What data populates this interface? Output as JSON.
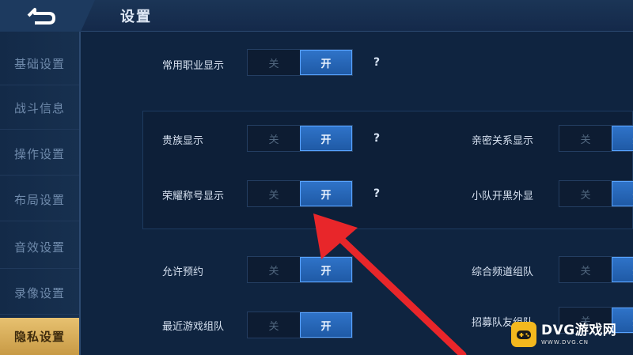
{
  "header": {
    "title": "设置",
    "back_icon": "back-arrow-icon"
  },
  "sidebar": {
    "items": [
      {
        "label": "基础设置",
        "active": false
      },
      {
        "label": "战斗信息",
        "active": false
      },
      {
        "label": "操作设置",
        "active": false
      },
      {
        "label": "布局设置",
        "active": false
      },
      {
        "label": "音效设置",
        "active": false
      },
      {
        "label": "录像设置",
        "active": false
      },
      {
        "label": "隐私设置",
        "active": true
      }
    ]
  },
  "settings": {
    "common_role": {
      "label": "常用职业显示",
      "off": "关",
      "on": "开",
      "value": "on",
      "help": "?"
    },
    "noble": {
      "label": "贵族显示",
      "off": "关",
      "on": "开",
      "value": "on",
      "help": "?"
    },
    "intimate": {
      "label": "亲密关系显示",
      "off": "关",
      "on": "开",
      "value": "on"
    },
    "honor_title": {
      "label": "荣耀称号显示",
      "off": "关",
      "on": "开",
      "value": "on",
      "help": "?"
    },
    "team_appearance": {
      "label": "小队开黑外显",
      "off": "关",
      "on": "开",
      "value": "on"
    },
    "allow_reserve": {
      "label": "允许预约",
      "off": "关",
      "on": "开",
      "value": "on"
    },
    "general_channel": {
      "label": "综合频道组队",
      "off": "关",
      "on": "开",
      "value": "on"
    },
    "recent_team": {
      "label": "最近游戏组队",
      "off": "关",
      "on": "开",
      "value": "on"
    },
    "recruit_team": {
      "label": "招募队友组队",
      "off": "关",
      "on": "开",
      "value": "on"
    }
  },
  "annotation": {
    "color": "#e8262a"
  },
  "watermark": {
    "title": "DVG游戏网",
    "subtitle": "WWW.DVG.CN",
    "color": "#f4b81e"
  }
}
